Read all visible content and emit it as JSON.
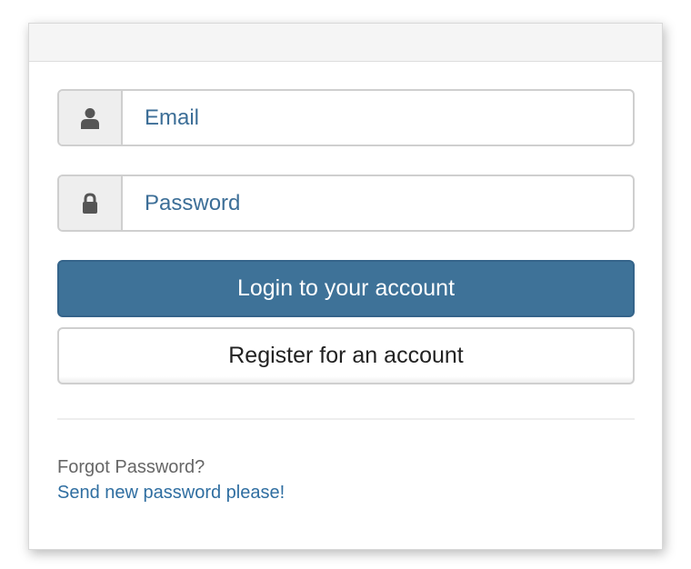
{
  "login_form": {
    "email": {
      "icon": "user-icon",
      "placeholder": "Email",
      "value": ""
    },
    "password": {
      "icon": "lock-icon",
      "placeholder": "Password",
      "value": ""
    },
    "login_button_label": "Login to your account",
    "register_button_label": "Register for an account",
    "forgot_label": "Forgot Password?",
    "send_password_link": "Send new password please!"
  },
  "colors": {
    "primary": "#3e7298",
    "link": "#2f6ea1",
    "placeholder": "#3c6e97"
  }
}
